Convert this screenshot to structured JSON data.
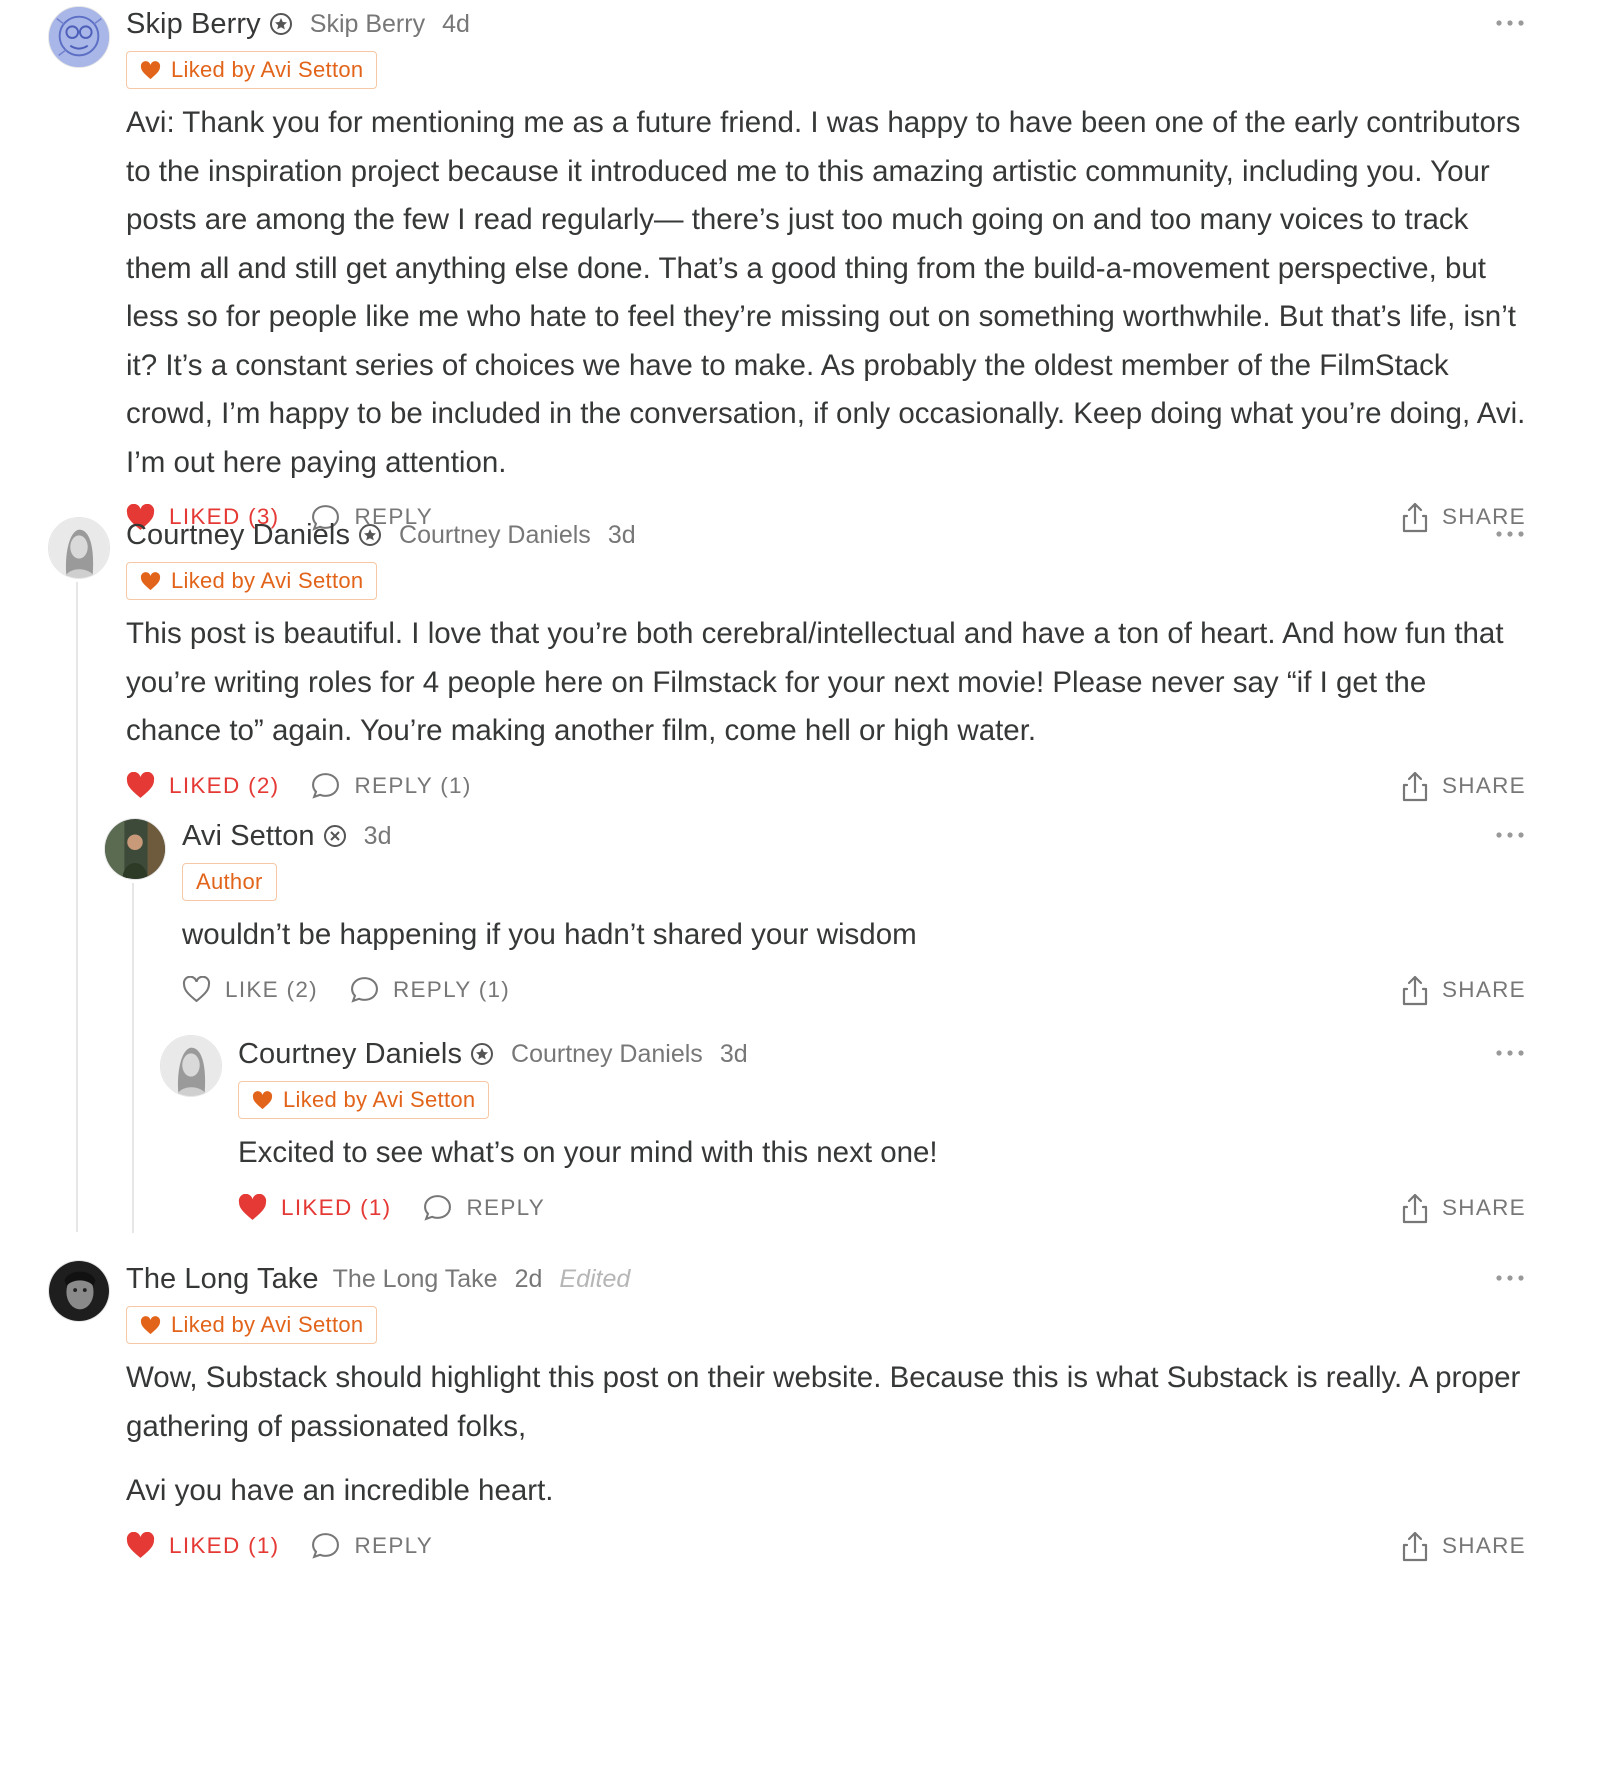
{
  "colors": {
    "accent": "#e2641a",
    "liked": "#e53935",
    "muted": "#777777",
    "text": "#363737"
  },
  "labels": {
    "liked_by": "Liked by Avi Setton",
    "share": "SHARE"
  },
  "comments": [
    {
      "name": "Skip Berry",
      "handle": "Skip Berry",
      "time": "4d",
      "badge": "Liked by Avi Setton",
      "paragraphs": [
        "Avi: Thank you for mentioning me as a future friend. I was happy to have been one of the early contributors to the inspiration project because it introduced me to this amazing artistic community, including you. Your posts are among the few I read regularly— there’s just too much going on and too many voices to track them all and still get anything else done. That’s a good thing from the build-a-movement perspective, but less so for people like me who hate to feel they’re missing out on something worthwhile. But that’s life, isn’t it? It’s a constant series of choices we have to make. As probably the oldest member of the FilmStack crowd, I’m happy to be included in the conversation, if only occasionally. Keep doing what you’re doing, Avi. I’m out here paying attention."
      ],
      "like_label": "LIKED (3)",
      "reply_label": "REPLY",
      "share_label": "SHARE"
    },
    {
      "name": "Courtney Daniels",
      "handle": "Courtney Daniels",
      "time": "3d",
      "badge": "Liked by Avi Setton",
      "paragraphs": [
        "This post is beautiful. I love that you’re both cerebral/intellectual and have a ton of heart. And how fun that you’re writing roles for 4 people here on Filmstack for your next movie! Please never say “if I get the chance to” again. You’re making another film, come hell or high water."
      ],
      "like_label": "LIKED (2)",
      "reply_label": "REPLY (1)",
      "share_label": "SHARE"
    },
    {
      "name": "Avi Setton",
      "time": "3d",
      "badge": "Author",
      "paragraphs": [
        "wouldn’t be happening if you hadn’t shared your wisdom"
      ],
      "like_label": "LIKE (2)",
      "reply_label": "REPLY (1)",
      "share_label": "SHARE"
    },
    {
      "name": "Courtney Daniels",
      "handle": "Courtney Daniels",
      "time": "3d",
      "badge": "Liked by Avi Setton",
      "paragraphs": [
        "Excited to see what’s on your mind with this next one!"
      ],
      "like_label": "LIKED (1)",
      "reply_label": "REPLY",
      "share_label": "SHARE"
    },
    {
      "name": "The Long Take",
      "handle": "The Long Take",
      "time": "2d",
      "edited": "Edited",
      "badge": "Liked by Avi Setton",
      "paragraphs": [
        "Wow, Substack should highlight this post on their website. Because this is what Substack is really. A proper gathering of passionated folks,",
        "Avi you have an incredible heart."
      ],
      "like_label": "LIKED (1)",
      "reply_label": "REPLY",
      "share_label": "SHARE"
    }
  ]
}
